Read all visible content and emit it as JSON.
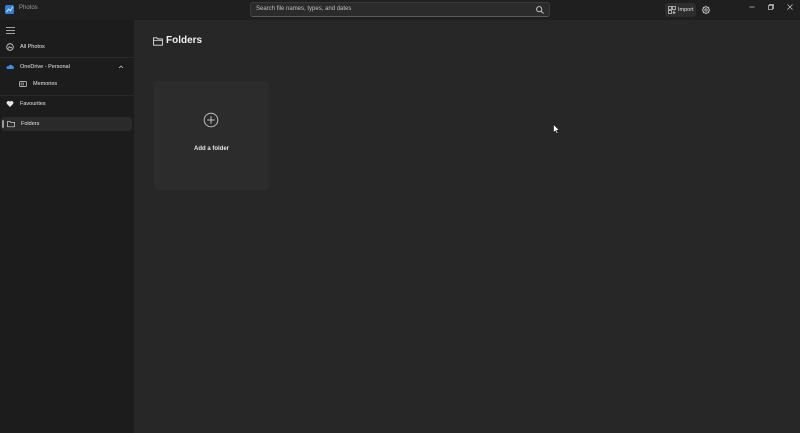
{
  "app": {
    "name": "Photos",
    "logo_color": "#4aa3f0"
  },
  "search": {
    "placeholder": "Search file names, types, and dates"
  },
  "titlebar": {
    "import_label": "Import"
  },
  "sidebar": {
    "items": [
      {
        "label": "All Photos",
        "icon": "all-photos-icon"
      },
      {
        "label": "OneDrive - Personal",
        "icon": "onedrive-cloud-icon"
      },
      {
        "label": "Memories",
        "icon": "memories-icon"
      },
      {
        "label": "Favourites",
        "icon": "heart-icon"
      },
      {
        "label": "Folders",
        "icon": "folder-icon",
        "selected": true
      }
    ]
  },
  "main": {
    "title": "Folders",
    "add_folder_label": "Add a folder"
  },
  "colors": {
    "sidebar_bg": "#1c1c1c",
    "main_bg": "#272727",
    "card_bg": "#2c2c2c",
    "onedrive_blue": "#3b8ee8"
  }
}
